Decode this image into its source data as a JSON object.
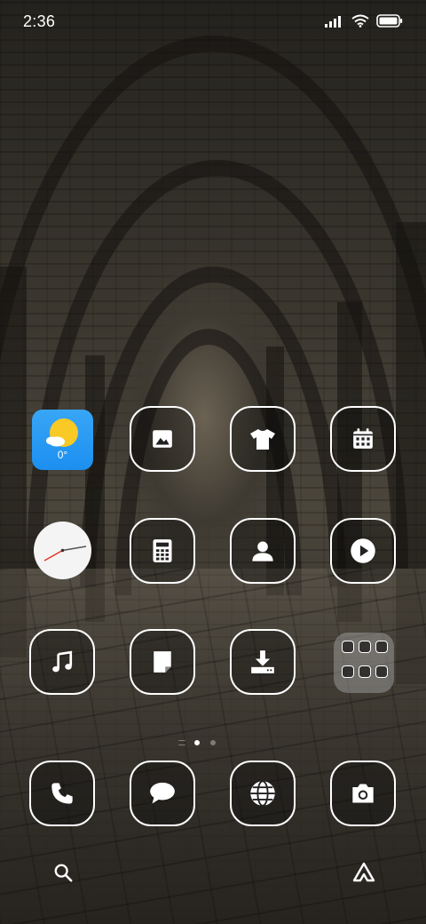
{
  "status_bar": {
    "time": "2:36",
    "icons": [
      "signal-icon",
      "wifi-icon",
      "battery-icon"
    ]
  },
  "widgets": {
    "weather": {
      "temperature": "0°",
      "icon": "sun-cloud-icon",
      "color": "#2196f3"
    },
    "clock": {
      "icon": "analog-clock-icon"
    }
  },
  "home_rows": [
    [
      "gallery",
      "themes",
      "calendar"
    ],
    [
      "calculator",
      "contacts",
      "video"
    ],
    [
      "music",
      "notes",
      "downloads",
      "tools-folder"
    ]
  ],
  "dock": [
    "phone",
    "messages",
    "browser",
    "camera"
  ],
  "page_indicator": {
    "pages": 2,
    "active": 1
  },
  "bottom_bar": {
    "left_icon": "search-icon",
    "right_icon": "app-vault-icon"
  },
  "colors": {
    "icon_outline": "#ffffff",
    "weather_blue": "#2196f3",
    "sun_yellow": "#f9c925"
  }
}
